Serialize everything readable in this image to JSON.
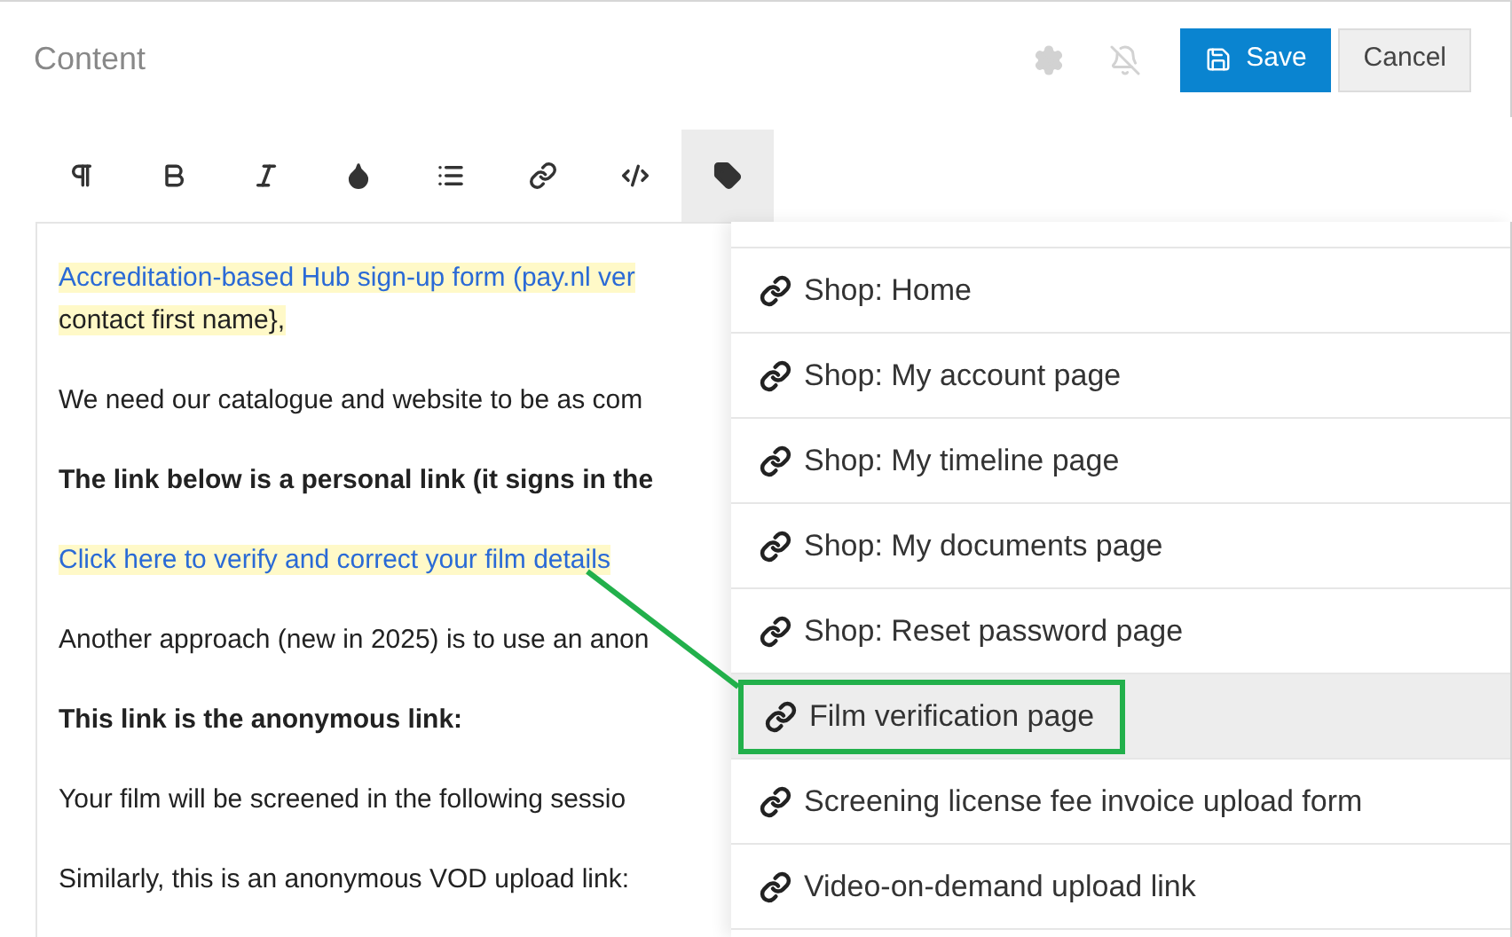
{
  "header": {
    "title": "Content",
    "save": "Save",
    "cancel": "Cancel"
  },
  "toolbar": [
    {
      "kind": "paragraph",
      "selected": false
    },
    {
      "kind": "bold",
      "selected": false
    },
    {
      "kind": "italic",
      "selected": false
    },
    {
      "kind": "color",
      "selected": false
    },
    {
      "kind": "list",
      "selected": false
    },
    {
      "kind": "link",
      "selected": false
    },
    {
      "kind": "code",
      "selected": false
    },
    {
      "kind": "tag",
      "selected": true
    }
  ],
  "editor": [
    {
      "kind": "link-highlight",
      "text": "Accreditation-based Hub sign-up form (pay.nl ver"
    },
    {
      "kind": "highlight",
      "text": "contact first name},"
    },
    {
      "kind": "gap"
    },
    {
      "kind": "plain",
      "text": "We need our catalogue and website to be as com"
    },
    {
      "kind": "gap"
    },
    {
      "kind": "bold",
      "text": "The link below is a personal link (it signs in the"
    },
    {
      "kind": "gap"
    },
    {
      "kind": "link-highlight",
      "text": "Click here to verify and correct your film details"
    },
    {
      "kind": "gap"
    },
    {
      "kind": "plain",
      "text": "Another approach (new in 2025) is to use an anon"
    },
    {
      "kind": "gap"
    },
    {
      "kind": "bold",
      "text": "This link is the anonymous link:"
    },
    {
      "kind": "gap"
    },
    {
      "kind": "plain",
      "text": "Your film will be screened in the following sessio"
    },
    {
      "kind": "gap"
    },
    {
      "kind": "plain",
      "text": "Similarly, this is an anonymous VOD upload link:"
    }
  ],
  "dropdown": [
    {
      "label": "Shop: Home",
      "selected": false,
      "annotated": false
    },
    {
      "label": "Shop: My account page",
      "selected": false,
      "annotated": false
    },
    {
      "label": "Shop: My timeline page",
      "selected": false,
      "annotated": false
    },
    {
      "label": "Shop: My documents page",
      "selected": false,
      "annotated": false
    },
    {
      "label": "Shop: Reset password page",
      "selected": false,
      "annotated": false
    },
    {
      "label": "Film verification page",
      "selected": true,
      "annotated": true
    },
    {
      "label": "Screening license fee invoice upload form",
      "selected": false,
      "annotated": false
    },
    {
      "label": "Video-on-demand upload link",
      "selected": false,
      "annotated": false
    }
  ]
}
